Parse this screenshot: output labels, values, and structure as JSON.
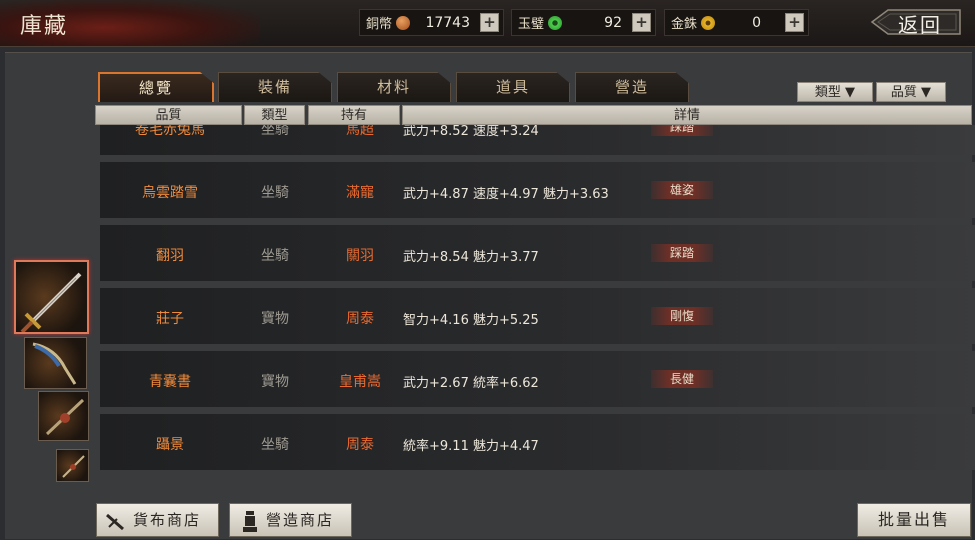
{
  "header": {
    "title": "庫藏",
    "back_label": "返回"
  },
  "resources": [
    {
      "label": "銅幣",
      "value": "17743",
      "coin_color": "#c26a2c"
    },
    {
      "label": "玉璧",
      "value": "92",
      "coin_color": "#3fbf3f"
    },
    {
      "label": "金銖",
      "value": "0",
      "coin_color": "#d9a21c"
    }
  ],
  "tabs": [
    "總覽",
    "裝備",
    "材料",
    "道具",
    "營造"
  ],
  "active_tab": 0,
  "filters": {
    "type": "類型 ▼",
    "quality": "品質 ▼"
  },
  "columns": [
    "品質",
    "類型",
    "持有",
    "詳情"
  ],
  "rows": [
    {
      "name": "卷毛赤兔馬",
      "type": "坐騎",
      "owner": "馬超",
      "stats": "武力+8.52 速度+3.24",
      "skill": "踩踏"
    },
    {
      "name": "烏雲踏雪",
      "type": "坐騎",
      "owner": "滿寵",
      "stats": "武力+4.87 速度+4.97 魅力+3.63",
      "skill": "雄姿"
    },
    {
      "name": "翻羽",
      "type": "坐騎",
      "owner": "關羽",
      "stats": "武力+8.54 魅力+3.77",
      "skill": "踩踏"
    },
    {
      "name": "莊子",
      "type": "寶物",
      "owner": "周泰",
      "stats": "智力+4.16 魅力+5.25",
      "skill": "剛愎"
    },
    {
      "name": "青囊書",
      "type": "寶物",
      "owner": "皇甫嵩",
      "stats": "武力+2.67 統率+6.62",
      "skill": "長健"
    },
    {
      "name": "躡景",
      "type": "坐騎",
      "owner": "周泰",
      "stats": "統率+9.11 魅力+4.47",
      "skill": ""
    }
  ],
  "bottom": {
    "shop1": "貨布商店",
    "shop2": "營造商店",
    "bulk_sell": "批量出售"
  }
}
